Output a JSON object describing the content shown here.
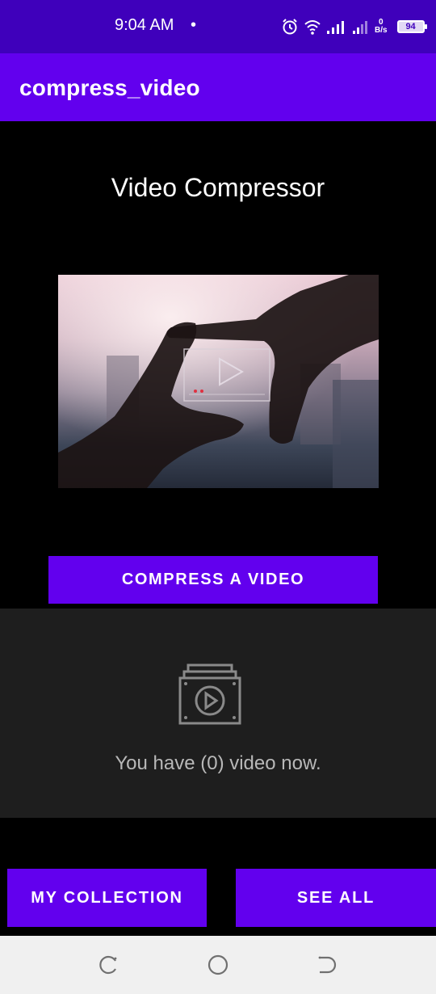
{
  "status_bar": {
    "time": "9:04 AM",
    "dot": "•",
    "net_speed_value": "0",
    "net_speed_unit": "B/s",
    "battery": "94",
    "icons": [
      "alarm-icon",
      "wifi-icon",
      "signal-icon",
      "signal-icon"
    ]
  },
  "app_bar": {
    "title": "compress_video"
  },
  "main": {
    "heading": "Video Compressor",
    "compress_button": "COMPRESS A VIDEO"
  },
  "empty_state": {
    "icon": "video-stack-icon",
    "message": "You have (0) video now."
  },
  "bottom_actions": {
    "collection_button": "MY COLLECTION",
    "see_all_button": "SEE ALL"
  },
  "nav_bar": {
    "icons": [
      "recent-apps-icon",
      "home-icon",
      "back-icon"
    ]
  },
  "colors": {
    "status_bar": "#3f00bb",
    "primary": "#6200ee",
    "background": "#000000",
    "panel": "#1e1e1e"
  }
}
